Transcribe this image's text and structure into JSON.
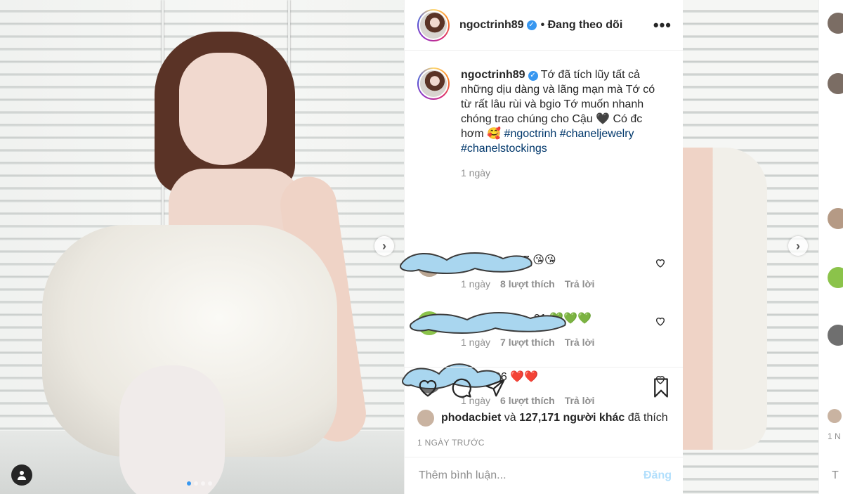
{
  "post": {
    "username": "ngoctrinh89",
    "follow_status": "• Đang theo dõi",
    "verified_mark": "✓",
    "more_label": "•••",
    "caption_text": "Tớ đã tích lũy tất cả những dịu dàng và lãng mạn mà Tớ có từ rất lâu rùi và bgio Tớ muốn nhanh chóng trao chúng cho Cậu 🖤 Có đc hơm 🥰",
    "hashtags": [
      "#ngoctrinh",
      "#chaneljewelry",
      "#chanelstockings"
    ],
    "caption_time": "1 ngày",
    "nav_next": "›",
    "carousel": {
      "total": 4,
      "active": 1
    }
  },
  "comments": [
    {
      "text_visible": "97 😘😘",
      "time": "1 ngày",
      "likes": "8 lượt thích",
      "reply": "Trả lời"
    },
    {
      "text_visible": "91 💚💚💚",
      "time": "1 ngày",
      "likes": "7 lượt thích",
      "reply": "Trả lời"
    },
    {
      "text_visible": "96 ❤️❤️",
      "time": "1 ngày",
      "likes": "6 lượt thích",
      "reply": "Trả lời"
    }
  ],
  "likes": {
    "user": "phodacbiet",
    "connector": "và",
    "others": "127,171 người khác",
    "suffix": "đã thích"
  },
  "date": "1 NGÀY TRƯỚC",
  "add_comment": {
    "placeholder": "Thêm bình luận...",
    "post_label": "Đăng"
  },
  "ghost": {
    "meta": "1 N",
    "letter": "T"
  },
  "colors": {
    "link": "#00376b",
    "verified": "#3897f0",
    "muted": "#8e8e8e",
    "post_disabled": "#b2dffc"
  }
}
